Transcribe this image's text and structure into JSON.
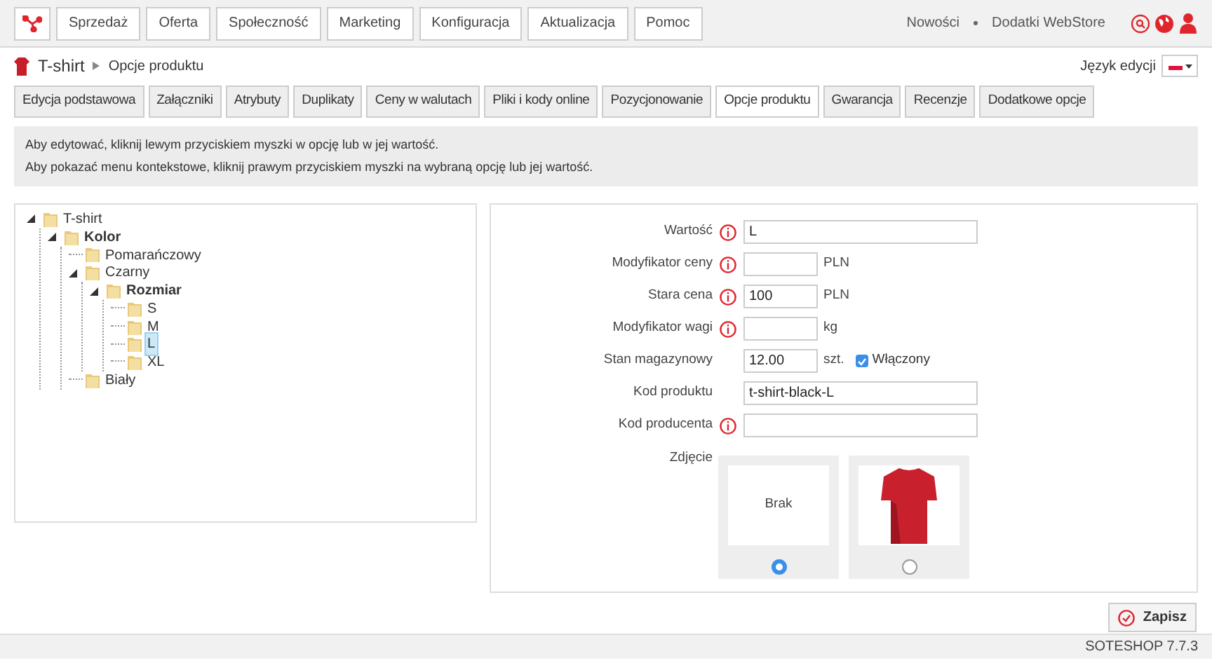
{
  "menu": [
    "Sprzedaż",
    "Oferta",
    "Społeczność",
    "Marketing",
    "Konfiguracja",
    "Aktualizacja",
    "Pomoc"
  ],
  "top_links": [
    "Nowości",
    "Dodatki WebStore"
  ],
  "breadcrumb": [
    "T-shirt",
    "Opcje produktu"
  ],
  "language": {
    "label": "Język edycji"
  },
  "tabs": [
    {
      "label": "Edycja podstawowa",
      "selected": false
    },
    {
      "label": "Załączniki",
      "selected": false
    },
    {
      "label": "Atrybuty",
      "selected": false
    },
    {
      "label": "Duplikaty",
      "selected": false
    },
    {
      "label": "Ceny w walutach",
      "selected": false
    },
    {
      "label": "Pliki i kody online",
      "selected": false
    },
    {
      "label": "Pozycjonowanie",
      "selected": false
    },
    {
      "label": "Opcje produktu",
      "selected": true
    },
    {
      "label": "Gwarancja",
      "selected": false
    },
    {
      "label": "Recenzje",
      "selected": false
    },
    {
      "label": "Dodatkowe opcje",
      "selected": false
    }
  ],
  "info": [
    "Aby edytować, kliknij lewym przyciskiem myszki w opcję lub w jej wartość.",
    "Aby pokazać menu kontekstowe, kliknij prawym przyciskiem myszki na wybraną opcję lub jej wartość."
  ],
  "tree": [
    {
      "label": "T-shirt",
      "kind": "value",
      "selected": false,
      "children": [
        {
          "label": "Kolor",
          "kind": "group",
          "selected": false,
          "children": [
            {
              "label": "Pomarańczowy",
              "kind": "value",
              "selected": false
            },
            {
              "label": "Czarny",
              "kind": "value",
              "selected": false,
              "children": [
                {
                  "label": "Rozmiar",
                  "kind": "group",
                  "selected": false,
                  "children": [
                    {
                      "label": "S",
                      "kind": "value",
                      "selected": false
                    },
                    {
                      "label": "M",
                      "kind": "value",
                      "selected": false
                    },
                    {
                      "label": "L",
                      "kind": "value",
                      "selected": true
                    },
                    {
                      "label": "XL",
                      "kind": "value",
                      "selected": false
                    }
                  ]
                }
              ]
            },
            {
              "label": "Biały",
              "kind": "value",
              "selected": false
            }
          ]
        }
      ]
    }
  ],
  "form": [
    {
      "label": "Wartość",
      "info": true,
      "value": "L",
      "kind": "long"
    },
    {
      "label": "Modyfikator ceny",
      "info": true,
      "kind": "short",
      "unit": "PLN"
    },
    {
      "label": "Stara cena",
      "info": true,
      "value": "100",
      "kind": "short",
      "unit": "PLN"
    },
    {
      "label": "Modyfikator wagi",
      "info": true,
      "kind": "short",
      "unit": "kg"
    },
    {
      "label": "Stan magazynowy",
      "info": false,
      "value": "12.00",
      "kind": "short",
      "unit": "szt.",
      "checkbox": {
        "label": "Włączony",
        "checked": true
      }
    },
    {
      "label": "Kod produktu",
      "info": false,
      "value": "t-shirt-black-L",
      "kind": "long"
    },
    {
      "label": "Kod producenta",
      "info": true,
      "kind": "long"
    }
  ],
  "photo": {
    "label": "Zdjęcie",
    "options": [
      {
        "kind": "none",
        "text": "Brak",
        "selected": true
      },
      {
        "kind": "image",
        "selected": false
      }
    ]
  },
  "save_button": "Zapisz",
  "status_bar": "SOTESHOP 7.7.3"
}
